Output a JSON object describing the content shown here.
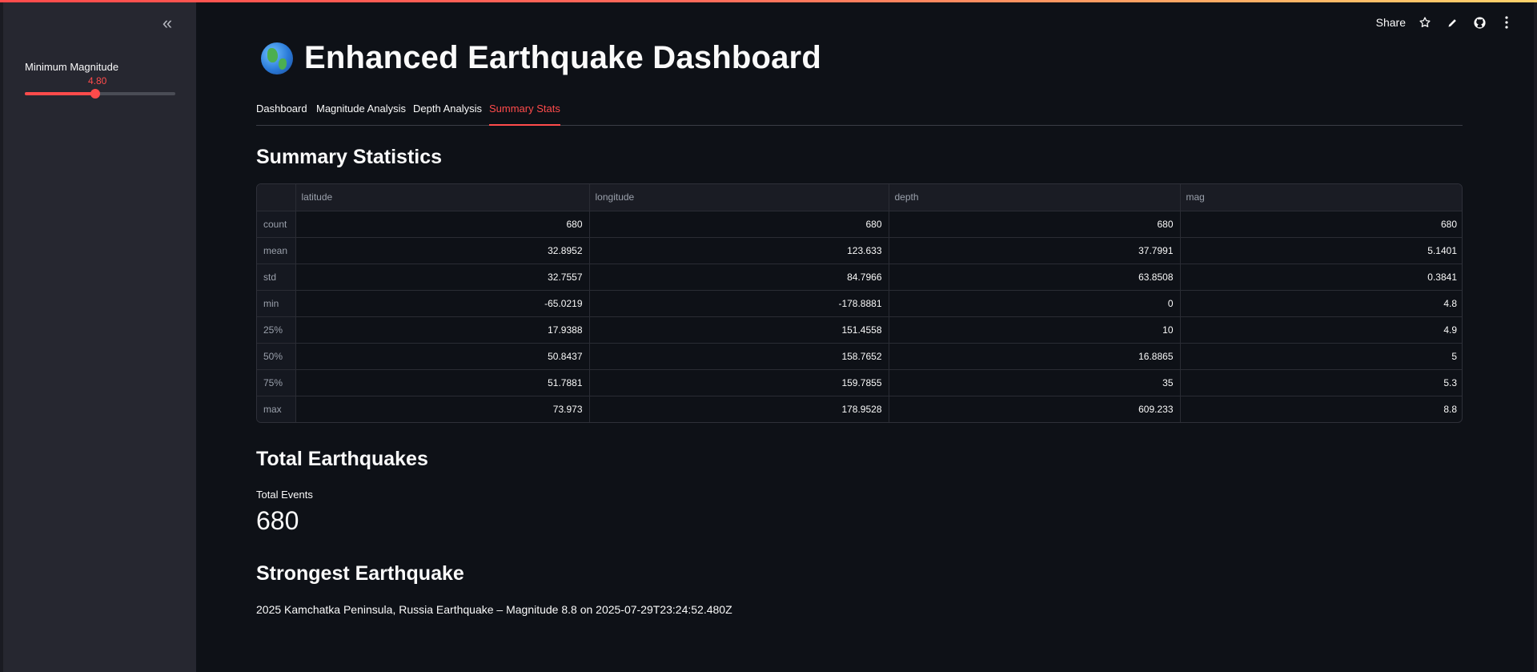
{
  "sidebar": {
    "collapse_icon": "double-chevron-left-icon",
    "slider": {
      "label": "Minimum Magnitude",
      "value": "4.80",
      "fraction": 0.47
    }
  },
  "toolbar": {
    "share_label": "Share",
    "icons": [
      "star-icon",
      "pencil-icon",
      "github-icon",
      "more-vertical-icon"
    ]
  },
  "header": {
    "emoji_icon": "globe-americas-icon",
    "title": "Enhanced Earthquake Dashboard"
  },
  "tabs": [
    {
      "label": "Dashboard",
      "active": false
    },
    {
      "label": "Magnitude Analysis",
      "active": false
    },
    {
      "label": "Depth Analysis",
      "active": false
    },
    {
      "label": "Summary Stats",
      "active": true
    }
  ],
  "summary": {
    "heading": "Summary Statistics",
    "columns": [
      "latitude",
      "longitude",
      "depth",
      "mag"
    ],
    "rows": [
      {
        "label": "count",
        "values": [
          "680",
          "680",
          "680",
          "680"
        ]
      },
      {
        "label": "mean",
        "values": [
          "32.8952",
          "123.633",
          "37.7991",
          "5.1401"
        ]
      },
      {
        "label": "std",
        "values": [
          "32.7557",
          "84.7966",
          "63.8508",
          "0.3841"
        ]
      },
      {
        "label": "min",
        "values": [
          "-65.0219",
          "-178.8881",
          "0",
          "4.8"
        ]
      },
      {
        "label": "25%",
        "values": [
          "17.9388",
          "151.4558",
          "10",
          "4.9"
        ]
      },
      {
        "label": "50%",
        "values": [
          "50.8437",
          "158.7652",
          "16.8865",
          "5"
        ]
      },
      {
        "label": "75%",
        "values": [
          "51.7881",
          "159.7855",
          "35",
          "5.3"
        ]
      },
      {
        "label": "max",
        "values": [
          "73.973",
          "178.9528",
          "609.233",
          "8.8"
        ]
      }
    ]
  },
  "total": {
    "heading": "Total Earthquakes",
    "metric_label": "Total Events",
    "metric_value": "680"
  },
  "strongest": {
    "heading": "Strongest Earthquake",
    "text": "2025 Kamchatka Peninsula, Russia Earthquake – Magnitude 8.8 on 2025-07-29T23:24:52.480Z"
  },
  "colors": {
    "accent": "#ff4b4b",
    "background": "#0e1117",
    "sidebar": "#262730"
  }
}
